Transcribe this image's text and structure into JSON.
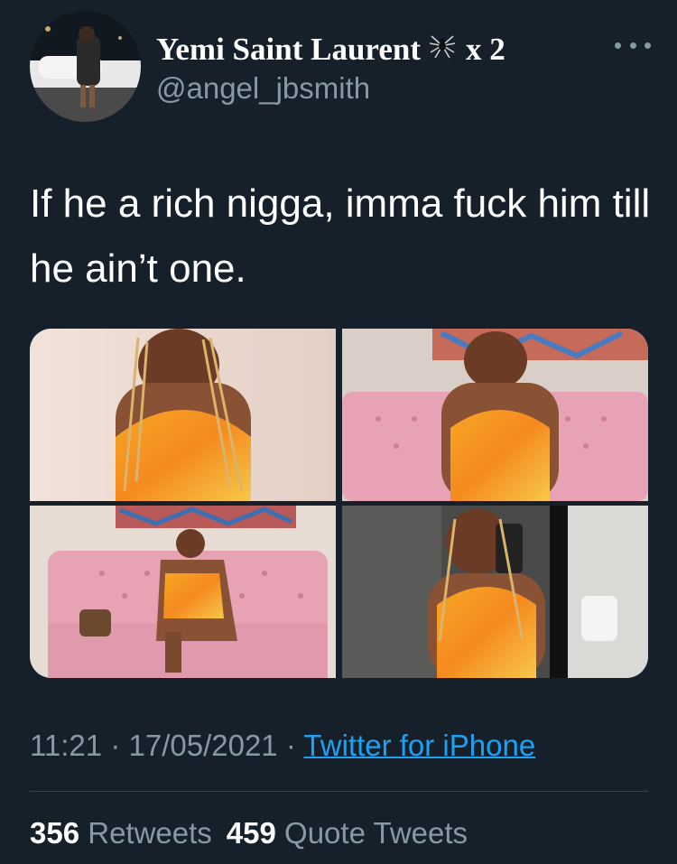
{
  "author": {
    "display_name": "Yemi Saint Laurent",
    "name_suffix": "x 2",
    "handle": "@angel_jbsmith",
    "avatar_icon": "profile-photo",
    "emoji_icon": "spider-icon"
  },
  "tweet": {
    "text": "If he a rich nigga, imma fuck him till he ain’t one.",
    "time": "11:21",
    "separator": "·",
    "date": "17/05/2021",
    "source": "Twitter for iPhone"
  },
  "media": [
    {
      "name": "photo-1",
      "description_icon": "photo"
    },
    {
      "name": "photo-2",
      "description_icon": "photo"
    },
    {
      "name": "photo-3",
      "description_icon": "photo"
    },
    {
      "name": "photo-4",
      "description_icon": "photo"
    }
  ],
  "stats": {
    "retweets_count": "356",
    "retweets_label": "Retweets",
    "quotes_count": "459",
    "quotes_label": "Quote Tweets"
  },
  "colors": {
    "background": "#15202b",
    "text": "#ffffff",
    "muted": "#8899a6",
    "link": "#1da1f2",
    "divider": "#38444d"
  }
}
